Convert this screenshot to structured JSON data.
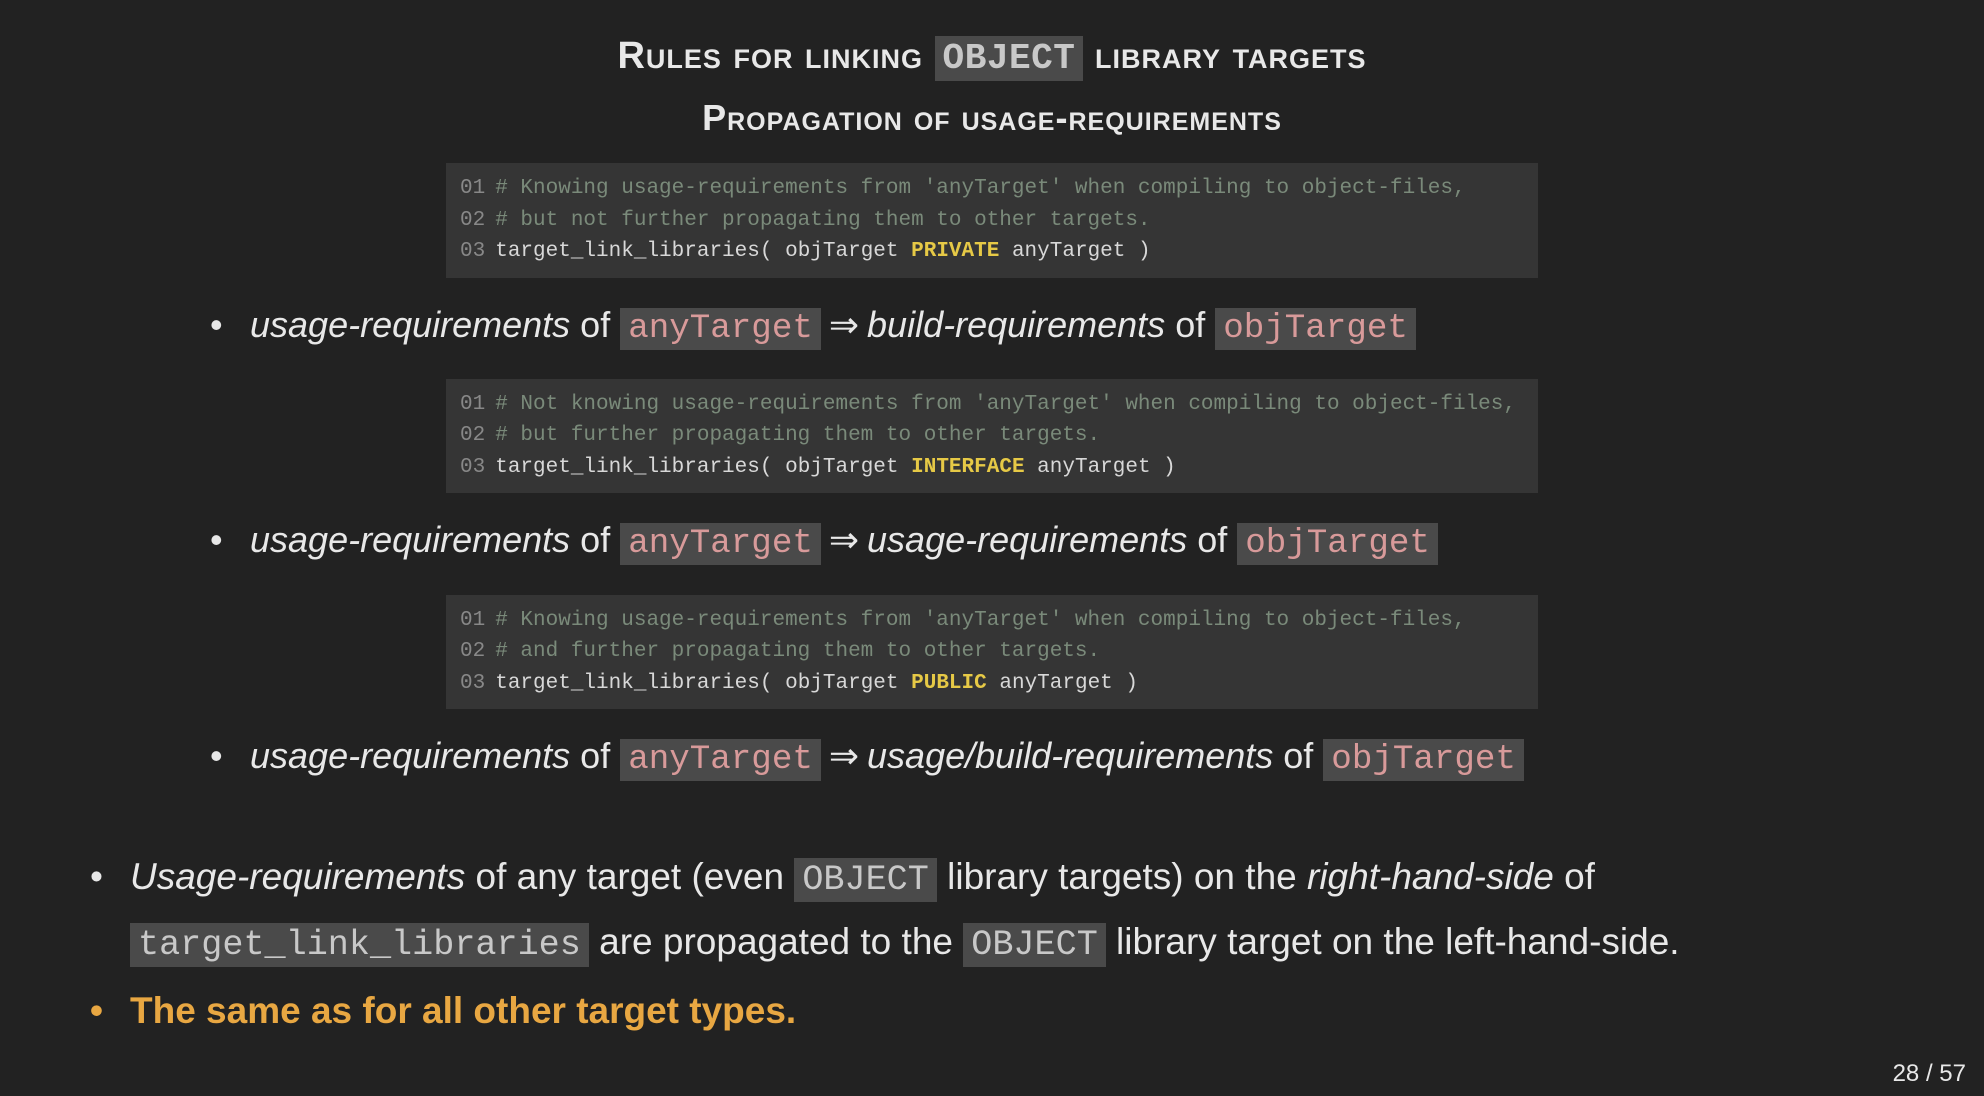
{
  "slide": {
    "title_pre": "Rules for linking ",
    "title_tag": "OBJECT",
    "title_post": " library targets",
    "subtitle": "Propagation of usage-requirements"
  },
  "code_blocks": [
    {
      "lines": [
        {
          "num": "01",
          "type": "comment",
          "text": "# Knowing usage-requirements from 'anyTarget' when compiling to object-files,"
        },
        {
          "num": "02",
          "type": "comment",
          "text": "# but not further propagating them to other targets."
        },
        {
          "num": "03",
          "type": "code",
          "func": "target_link_libraries",
          "arg1": "objTarget",
          "kw": "PRIVATE",
          "arg2": "anyTarget"
        }
      ]
    },
    {
      "lines": [
        {
          "num": "01",
          "type": "comment",
          "text": "# Not knowing usage-requirements from 'anyTarget' when compiling to object-files,"
        },
        {
          "num": "02",
          "type": "comment",
          "text": "# but further propagating them to other targets."
        },
        {
          "num": "03",
          "type": "code",
          "func": "target_link_libraries",
          "arg1": "objTarget",
          "kw": "INTERFACE",
          "arg2": "anyTarget"
        }
      ]
    },
    {
      "lines": [
        {
          "num": "01",
          "type": "comment",
          "text": "# Knowing usage-requirements from 'anyTarget' when compiling to object-files,"
        },
        {
          "num": "02",
          "type": "comment",
          "text": "# and further propagating them to other targets."
        },
        {
          "num": "03",
          "type": "code",
          "func": "target_link_libraries",
          "arg1": "objTarget",
          "kw": "PUBLIC",
          "arg2": "anyTarget"
        }
      ]
    }
  ],
  "bullets": [
    {
      "left_term": "usage-requirements",
      "of1": " of ",
      "t1": "anyTarget",
      "arrow": "⇒",
      "right_term": "build-requirements",
      "of2": " of ",
      "t2": "objTarget"
    },
    {
      "left_term": "usage-requirements",
      "of1": " of ",
      "t1": "anyTarget",
      "arrow": "⇒",
      "right_term": "usage-requirements",
      "of2": " of ",
      "t2": "objTarget"
    },
    {
      "left_term": "usage-requirements",
      "of1": " of ",
      "t1": "anyTarget",
      "arrow": "⇒",
      "right_term": "usage/build-requirements",
      "of2": " of ",
      "t2": "objTarget"
    }
  ],
  "bottom": {
    "line1": {
      "p1_italic": "Usage-requirements",
      "p2": " of any target (even ",
      "tag1": "OBJECT",
      "p3": " library targets) on the ",
      "p4_italic": "right-hand-side",
      "p5": " of ",
      "tag2": "target_link_libraries",
      "p6": " are propagated to the ",
      "tag3": "OBJECT",
      "p7": " library target on the left-hand-side."
    },
    "line2": "The same as for all other target types."
  },
  "page": {
    "current": "28",
    "sep": " / ",
    "total": "57"
  }
}
